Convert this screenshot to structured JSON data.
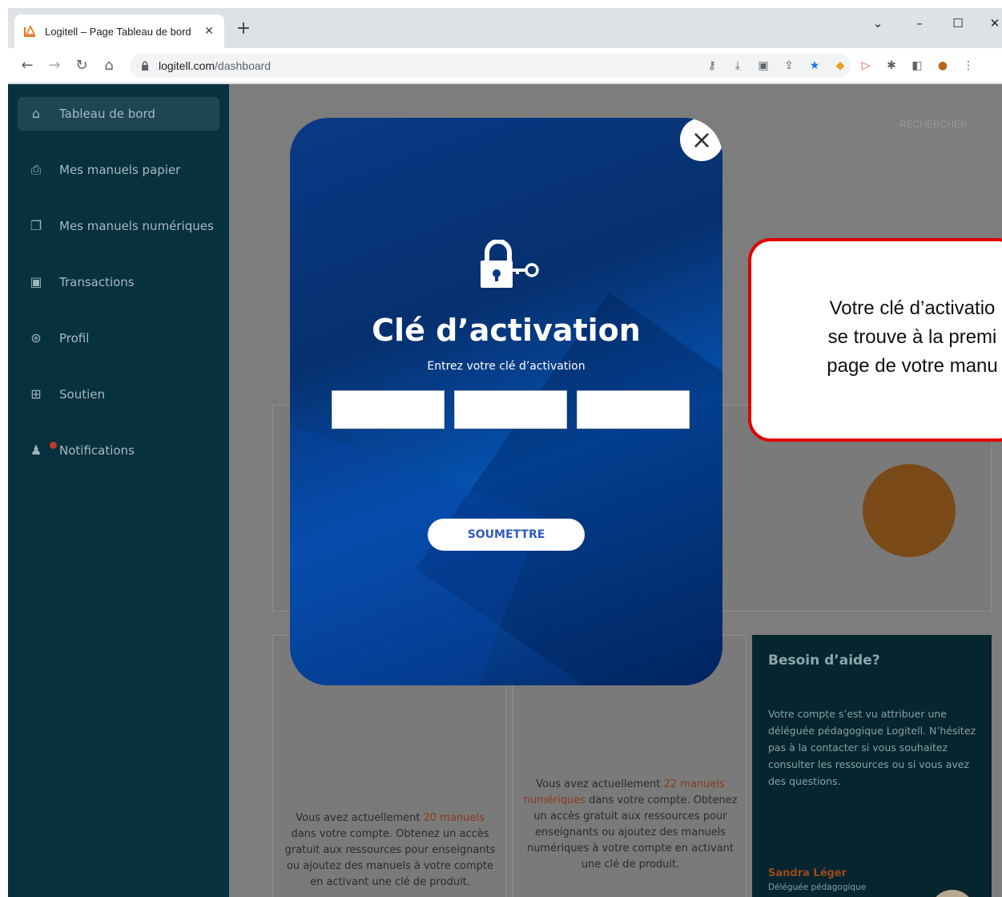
{
  "browser": {
    "tab_title": "Logitell – Page Tableau de bord",
    "tab_close": "✕",
    "new_tab": "+",
    "url_host": "logitell.com",
    "url_path": "/dashboard",
    "window_controls": {
      "menu": "⌄",
      "minimize": "–",
      "maximize": "☐",
      "close": "✕"
    }
  },
  "sidebar": {
    "items": [
      {
        "label": "Tableau de bord",
        "icon": "home-icon"
      },
      {
        "label": "Mes manuels papier",
        "icon": "printer-icon"
      },
      {
        "label": "Mes manuels numériques",
        "icon": "book-icon"
      },
      {
        "label": "Transactions",
        "icon": "money-icon"
      },
      {
        "label": "Profil",
        "icon": "user-circle-icon"
      },
      {
        "label": "Soutien",
        "icon": "support-icon"
      },
      {
        "label": "Notifications",
        "icon": "bell-icon"
      }
    ]
  },
  "main": {
    "search_label": "RECHERCHER",
    "card_paper": {
      "text_before": "Vous avez actuellement ",
      "highlight": "20 manuels",
      "text_after": "dans votre compte. Obtenez un accès gratuit aux ressources pour enseignants ou ajoutez des manuels à votre compte en activant une clé de produit."
    },
    "card_digital": {
      "text_before": "Vous avez actuellement ",
      "highlight": "22 manuels numériques",
      "text_after": " dans votre compte. Obtenez un accès gratuit aux ressources pour enseignants ou ajoutez des manuels numériques à votre compte en activant une clé de produit."
    },
    "help": {
      "title": "Besoin d’aide?",
      "body": "Votre compte s’est vu attribuer une déléguée pédagogique Logitell. N’hésitez pas à la contacter si vous souhaitez consulter les ressources ou si vous avez des questions.",
      "name": "Sandra Léger",
      "role": "Déléguée pédagogique"
    }
  },
  "modal": {
    "close": "×",
    "title": "Clé d’activation",
    "subtitle": "Entrez votre clé d’activation",
    "submit": "SOUMETTRE"
  },
  "callout": {
    "line1": "Votre clé d’activatio",
    "line2": "se trouve à la premi",
    "line3": "page de votre manu"
  },
  "colors": {
    "sidebar": "#08313f",
    "accent_orange": "#e8741e",
    "callout_border": "#e00000",
    "modal_blue": "#0a3a86"
  }
}
